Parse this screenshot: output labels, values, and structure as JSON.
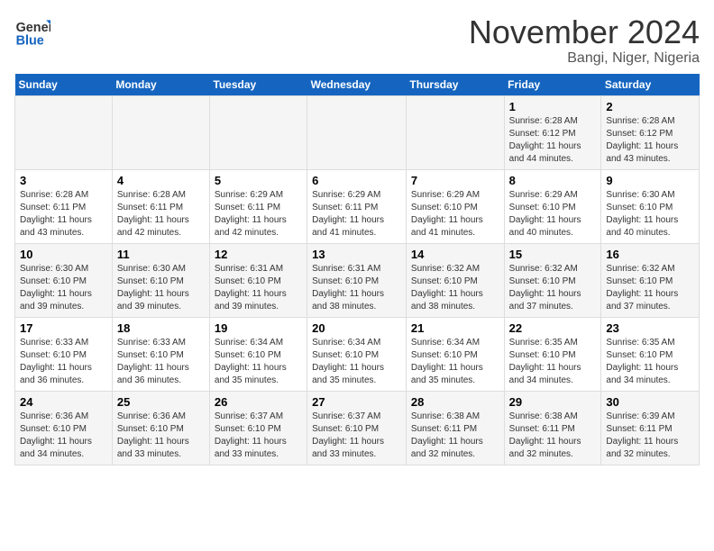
{
  "header": {
    "logo_line1": "General",
    "logo_line2": "Blue",
    "month_title": "November 2024",
    "location": "Bangi, Niger, Nigeria"
  },
  "calendar": {
    "days_of_week": [
      "Sunday",
      "Monday",
      "Tuesday",
      "Wednesday",
      "Thursday",
      "Friday",
      "Saturday"
    ],
    "weeks": [
      [
        {
          "num": "",
          "info": ""
        },
        {
          "num": "",
          "info": ""
        },
        {
          "num": "",
          "info": ""
        },
        {
          "num": "",
          "info": ""
        },
        {
          "num": "",
          "info": ""
        },
        {
          "num": "1",
          "info": "Sunrise: 6:28 AM\nSunset: 6:12 PM\nDaylight: 11 hours\nand 44 minutes."
        },
        {
          "num": "2",
          "info": "Sunrise: 6:28 AM\nSunset: 6:12 PM\nDaylight: 11 hours\nand 43 minutes."
        }
      ],
      [
        {
          "num": "3",
          "info": "Sunrise: 6:28 AM\nSunset: 6:11 PM\nDaylight: 11 hours\nand 43 minutes."
        },
        {
          "num": "4",
          "info": "Sunrise: 6:28 AM\nSunset: 6:11 PM\nDaylight: 11 hours\nand 42 minutes."
        },
        {
          "num": "5",
          "info": "Sunrise: 6:29 AM\nSunset: 6:11 PM\nDaylight: 11 hours\nand 42 minutes."
        },
        {
          "num": "6",
          "info": "Sunrise: 6:29 AM\nSunset: 6:11 PM\nDaylight: 11 hours\nand 41 minutes."
        },
        {
          "num": "7",
          "info": "Sunrise: 6:29 AM\nSunset: 6:10 PM\nDaylight: 11 hours\nand 41 minutes."
        },
        {
          "num": "8",
          "info": "Sunrise: 6:29 AM\nSunset: 6:10 PM\nDaylight: 11 hours\nand 40 minutes."
        },
        {
          "num": "9",
          "info": "Sunrise: 6:30 AM\nSunset: 6:10 PM\nDaylight: 11 hours\nand 40 minutes."
        }
      ],
      [
        {
          "num": "10",
          "info": "Sunrise: 6:30 AM\nSunset: 6:10 PM\nDaylight: 11 hours\nand 39 minutes."
        },
        {
          "num": "11",
          "info": "Sunrise: 6:30 AM\nSunset: 6:10 PM\nDaylight: 11 hours\nand 39 minutes."
        },
        {
          "num": "12",
          "info": "Sunrise: 6:31 AM\nSunset: 6:10 PM\nDaylight: 11 hours\nand 39 minutes."
        },
        {
          "num": "13",
          "info": "Sunrise: 6:31 AM\nSunset: 6:10 PM\nDaylight: 11 hours\nand 38 minutes."
        },
        {
          "num": "14",
          "info": "Sunrise: 6:32 AM\nSunset: 6:10 PM\nDaylight: 11 hours\nand 38 minutes."
        },
        {
          "num": "15",
          "info": "Sunrise: 6:32 AM\nSunset: 6:10 PM\nDaylight: 11 hours\nand 37 minutes."
        },
        {
          "num": "16",
          "info": "Sunrise: 6:32 AM\nSunset: 6:10 PM\nDaylight: 11 hours\nand 37 minutes."
        }
      ],
      [
        {
          "num": "17",
          "info": "Sunrise: 6:33 AM\nSunset: 6:10 PM\nDaylight: 11 hours\nand 36 minutes."
        },
        {
          "num": "18",
          "info": "Sunrise: 6:33 AM\nSunset: 6:10 PM\nDaylight: 11 hours\nand 36 minutes."
        },
        {
          "num": "19",
          "info": "Sunrise: 6:34 AM\nSunset: 6:10 PM\nDaylight: 11 hours\nand 35 minutes."
        },
        {
          "num": "20",
          "info": "Sunrise: 6:34 AM\nSunset: 6:10 PM\nDaylight: 11 hours\nand 35 minutes."
        },
        {
          "num": "21",
          "info": "Sunrise: 6:34 AM\nSunset: 6:10 PM\nDaylight: 11 hours\nand 35 minutes."
        },
        {
          "num": "22",
          "info": "Sunrise: 6:35 AM\nSunset: 6:10 PM\nDaylight: 11 hours\nand 34 minutes."
        },
        {
          "num": "23",
          "info": "Sunrise: 6:35 AM\nSunset: 6:10 PM\nDaylight: 11 hours\nand 34 minutes."
        }
      ],
      [
        {
          "num": "24",
          "info": "Sunrise: 6:36 AM\nSunset: 6:10 PM\nDaylight: 11 hours\nand 34 minutes."
        },
        {
          "num": "25",
          "info": "Sunrise: 6:36 AM\nSunset: 6:10 PM\nDaylight: 11 hours\nand 33 minutes."
        },
        {
          "num": "26",
          "info": "Sunrise: 6:37 AM\nSunset: 6:10 PM\nDaylight: 11 hours\nand 33 minutes."
        },
        {
          "num": "27",
          "info": "Sunrise: 6:37 AM\nSunset: 6:10 PM\nDaylight: 11 hours\nand 33 minutes."
        },
        {
          "num": "28",
          "info": "Sunrise: 6:38 AM\nSunset: 6:11 PM\nDaylight: 11 hours\nand 32 minutes."
        },
        {
          "num": "29",
          "info": "Sunrise: 6:38 AM\nSunset: 6:11 PM\nDaylight: 11 hours\nand 32 minutes."
        },
        {
          "num": "30",
          "info": "Sunrise: 6:39 AM\nSunset: 6:11 PM\nDaylight: 11 hours\nand 32 minutes."
        }
      ]
    ]
  }
}
